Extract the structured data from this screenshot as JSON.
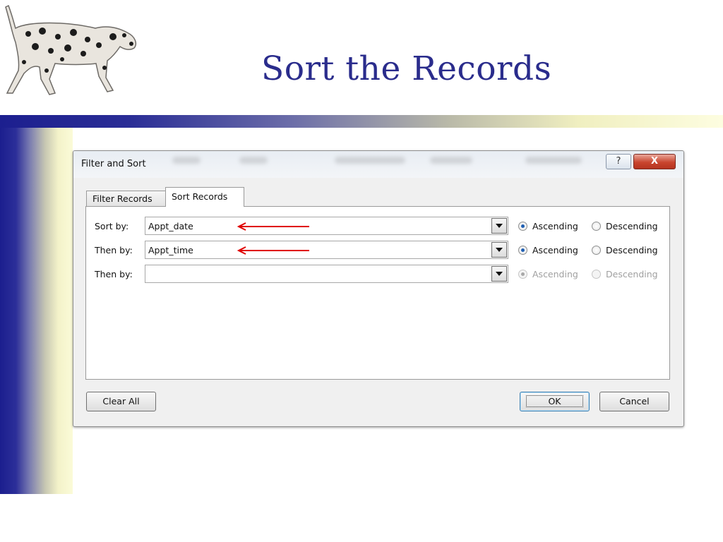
{
  "slide": {
    "title": "Sort the Records"
  },
  "dialog": {
    "title": "Filter and Sort",
    "help_button": "?",
    "close_button": "X",
    "tabs": [
      {
        "label": "Filter Records",
        "active": false
      },
      {
        "label": "Sort Records",
        "active": true
      }
    ],
    "rows": [
      {
        "label": "Sort by:",
        "value": "Appt_date",
        "ascending": "Ascending",
        "descending": "Descending",
        "selected": "ascending",
        "enabled": true
      },
      {
        "label": "Then by:",
        "value": "Appt_time",
        "ascending": "Ascending",
        "descending": "Descending",
        "selected": "ascending",
        "enabled": true
      },
      {
        "label": "Then by:",
        "value": "",
        "ascending": "Ascending",
        "descending": "Descending",
        "selected": "ascending",
        "enabled": false
      }
    ],
    "clear_all_button": "Clear All",
    "ok_button": "OK",
    "cancel_button": "Cancel"
  },
  "colors": {
    "title": "#2a2c8c",
    "arrow": "#e00000",
    "close": "#c9452f"
  }
}
